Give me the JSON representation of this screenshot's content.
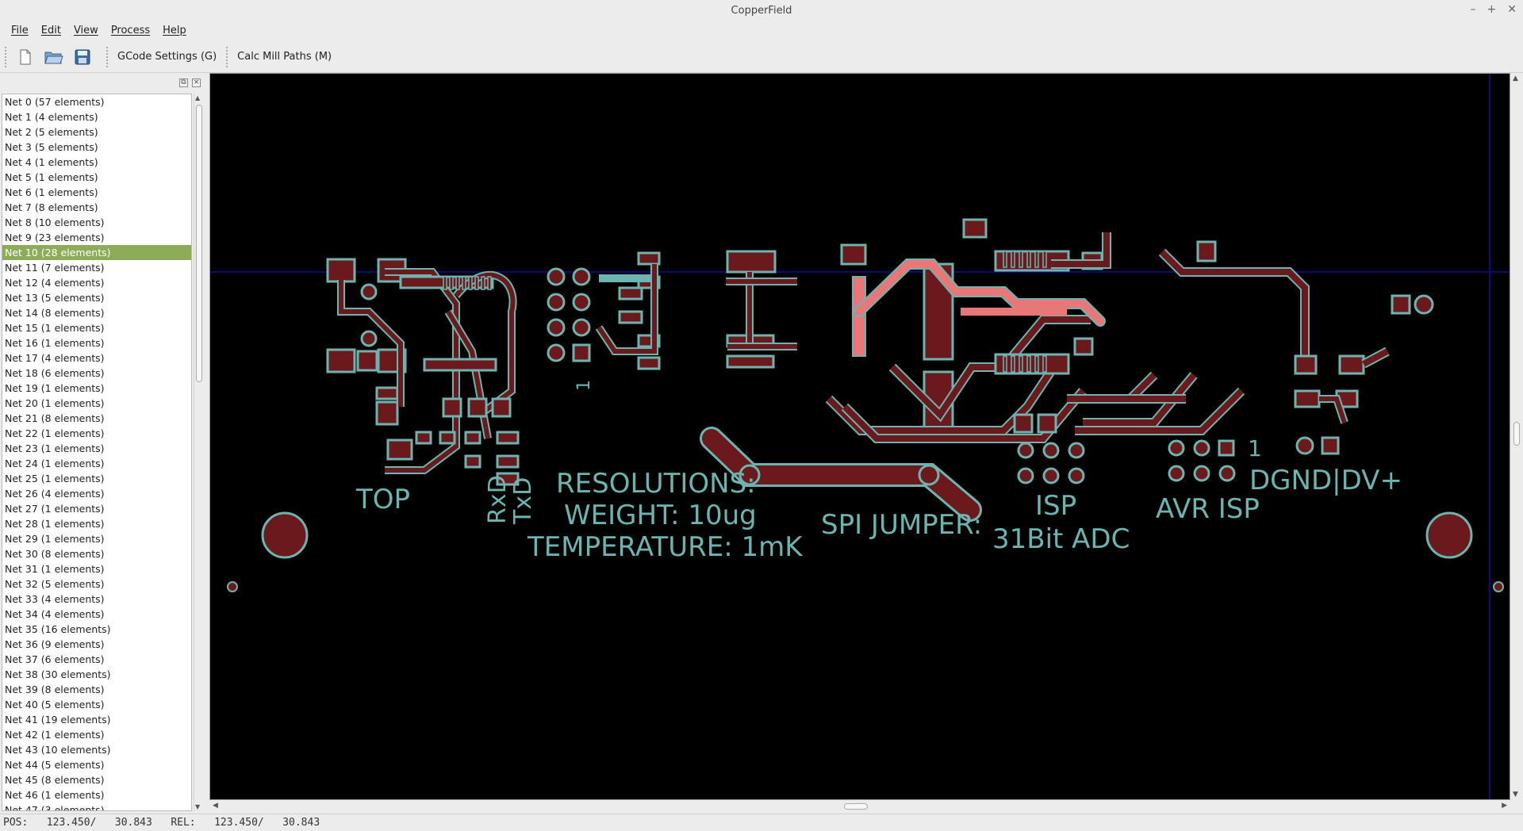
{
  "window": {
    "title": "CopperField"
  },
  "menu": [
    "File",
    "Edit",
    "View",
    "Process",
    "Help"
  ],
  "toolbar": {
    "gcode_label": "GCode Settings (G)",
    "mill_label": "Calc Mill Paths (M)"
  },
  "nets": [
    "Net 0 (57 elements)",
    "Net 1 (4 elements)",
    "Net 2 (5 elements)",
    "Net 3 (5 elements)",
    "Net 4 (1 elements)",
    "Net 5 (1 elements)",
    "Net 6 (1 elements)",
    "Net 7 (8 elements)",
    "Net 8 (10 elements)",
    "Net 9 (23 elements)",
    "Net 10 (28 elements)",
    "Net 11 (7 elements)",
    "Net 12 (4 elements)",
    "Net 13 (5 elements)",
    "Net 14 (8 elements)",
    "Net 15 (1 elements)",
    "Net 16 (1 elements)",
    "Net 17 (4 elements)",
    "Net 18 (6 elements)",
    "Net 19 (1 elements)",
    "Net 20 (1 elements)",
    "Net 21 (8 elements)",
    "Net 22 (1 elements)",
    "Net 23 (1 elements)",
    "Net 24 (1 elements)",
    "Net 25 (1 elements)",
    "Net 26 (4 elements)",
    "Net 27 (1 elements)",
    "Net 28 (1 elements)",
    "Net 29 (1 elements)",
    "Net 30 (8 elements)",
    "Net 31 (1 elements)",
    "Net 32 (5 elements)",
    "Net 33 (4 elements)",
    "Net 34 (4 elements)",
    "Net 35 (16 elements)",
    "Net 36 (9 elements)",
    "Net 37 (6 elements)",
    "Net 38 (30 elements)",
    "Net 39 (8 elements)",
    "Net 40 (5 elements)",
    "Net 41 (19 elements)",
    "Net 42 (1 elements)",
    "Net 43 (10 elements)",
    "Net 44 (5 elements)",
    "Net 45 (8 elements)",
    "Net 46 (1 elements)",
    "Net 47 (3 elements)"
  ],
  "selected_net_index": 10,
  "pcb_labels": {
    "top": "TOP",
    "rxd": "RxD",
    "txd": "TxD",
    "resolutions": "RESOLUTIONS:",
    "weight": "WEIGHT: 10ug",
    "temperature": "TEMPERATURE: 1mK",
    "spi_jumper": "SPI JUMPER:",
    "isp": "ISP",
    "adc": "31Bit ADC",
    "avr_isp": "AVR ISP",
    "dgnd": "DGND|DV+",
    "pin1_a": "1",
    "pin1_b": "1"
  },
  "colors": {
    "board_bg": "#000000",
    "copper_fill": "#6a1a1c",
    "outline": "#6fb3b1",
    "highlight": "#e87878",
    "crosshair": "#1010a0",
    "selection": "#8cac5a"
  },
  "status": "POS:   123.450/   30.843   REL:   123.450/   30.843"
}
